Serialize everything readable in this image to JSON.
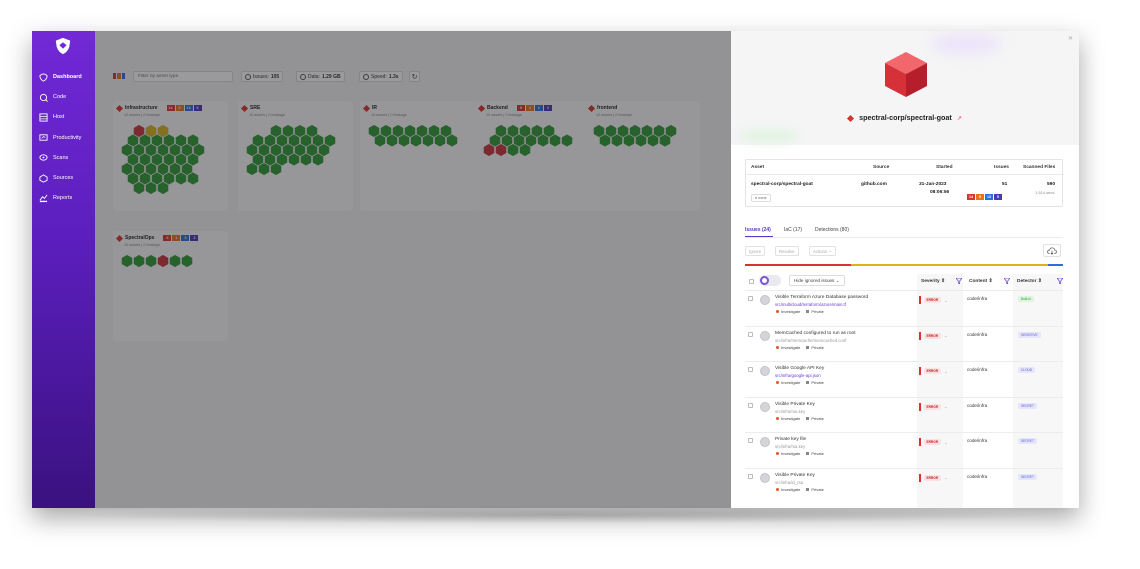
{
  "sidebar": {
    "items": [
      {
        "label": "Dashboard",
        "icon": "dashboard-icon",
        "active": true
      },
      {
        "label": "Code",
        "icon": "code-icon"
      },
      {
        "label": "Host",
        "icon": "host-icon"
      },
      {
        "label": "Productivity",
        "icon": "productivity-icon"
      },
      {
        "label": "Scans",
        "icon": "scans-icon"
      },
      {
        "label": "Sources",
        "icon": "sources-icon"
      },
      {
        "label": "Reports",
        "icon": "reports-icon"
      }
    ]
  },
  "toolbar": {
    "filter_placeholder": "Filter by asset type",
    "issues_label": "Issues:",
    "issues_value": "105",
    "data_label": "Data:",
    "data_value": "1.29 GB",
    "speed_label": "Speed:",
    "speed_value": "1.3s"
  },
  "teams": [
    {
      "name": "Infrastructure",
      "sub": "10 assets | 0 leakage",
      "sev": [
        "14",
        "3",
        "13",
        "5"
      ]
    },
    {
      "name": "SRE",
      "sub": "10 assets | 0 leakage",
      "sev": []
    },
    {
      "name": "IR",
      "sub": "10 assets | 0 leakage",
      "sev": []
    },
    {
      "name": "Backend",
      "sub": "10 assets | 0 leakage",
      "sev": [
        "5",
        "2",
        "1",
        "2"
      ]
    },
    {
      "name": "frontend",
      "sub": "10 assets | 0 leakage",
      "sev": []
    },
    {
      "name": "SpectralOps",
      "sub": "10 assets | 0 leakage",
      "sev": [
        "6",
        "1",
        "3",
        "2"
      ]
    }
  ],
  "panel": {
    "asset_name": "spectral-corp/spectral-goat",
    "table": {
      "headers": {
        "asset": "Asset",
        "source": "Source",
        "started": "Started",
        "issues": "Issues",
        "scanned": "Scanned Files"
      },
      "asset": "spectral-corp/spectral-goat",
      "tag": "# none",
      "source": "github.com",
      "started_date": "31-Jan-2023",
      "started_time": "08:06:56",
      "issues": "51",
      "issue_sevs": [
        "14",
        "6",
        "13",
        "5"
      ],
      "scanned_files": "590",
      "scanned_sub": "1,514 secs"
    },
    "tabs": [
      "Issues (24)",
      "IaC (17)",
      "Detections (80)"
    ],
    "actions": [
      "Ignore",
      "Resolve",
      "Actions"
    ],
    "columns": {
      "hide_ignored": "Hide ignored issues",
      "severity": "Severity",
      "content": "Content",
      "detector": "Detector"
    },
    "issues": [
      {
        "title": "Visible Terraform Azure Database password",
        "path": "src/multicloud/terraform/azure/main.tf",
        "path_link": true,
        "severity": "ERROR",
        "content": "code/infra",
        "detector": "Built-in",
        "det_color": "#2e9e3a",
        "det_bg": "#dff3df"
      },
      {
        "title": "MemCached configured to run as root",
        "path": "src/infra/memcache/memcached.conf",
        "path_link": false,
        "severity": "ERROR",
        "content": "code/infra",
        "detector": "SENSITIVE",
        "det_color": "#5b5bd6",
        "det_bg": "#e5e5fb"
      },
      {
        "title": "Visible Google API Key",
        "path": "src/infra/google-api.json",
        "path_link": true,
        "severity": "ERROR",
        "content": "code/infra",
        "detector": "CLOUD",
        "det_color": "#5b5bd6",
        "det_bg": "#e5e5fb"
      },
      {
        "title": "Visible Private Key",
        "path": "src/infra/rsa.key",
        "path_link": false,
        "severity": "ERROR",
        "content": "code/infra",
        "detector": "SECRET",
        "det_color": "#5b5bd6",
        "det_bg": "#e5e5fb"
      },
      {
        "title": "Private key file",
        "path": "src/infra/rsa.key",
        "path_link": false,
        "severity": "ERROR",
        "content": "code/infra",
        "detector": "SECRET",
        "det_color": "#5b5bd6",
        "det_bg": "#e5e5fb"
      },
      {
        "title": "Visible Private Key",
        "path": "src/infra/id_rsa",
        "path_link": false,
        "severity": "ERROR",
        "content": "code/infra",
        "detector": "SECRET",
        "det_color": "#5b5bd6",
        "det_bg": "#e5e5fb"
      }
    ],
    "investigate_label": "Investigate",
    "private_label": "Private"
  },
  "colors": {
    "critical": "#d9342c",
    "high": "#e8731a",
    "medium": "#2c6fd8",
    "low": "#4a3ab8",
    "hex_green": "#2f9a36",
    "hex_red": "#c8343a",
    "hex_yellow": "#d6b21e",
    "accent": "#5b35c9"
  }
}
